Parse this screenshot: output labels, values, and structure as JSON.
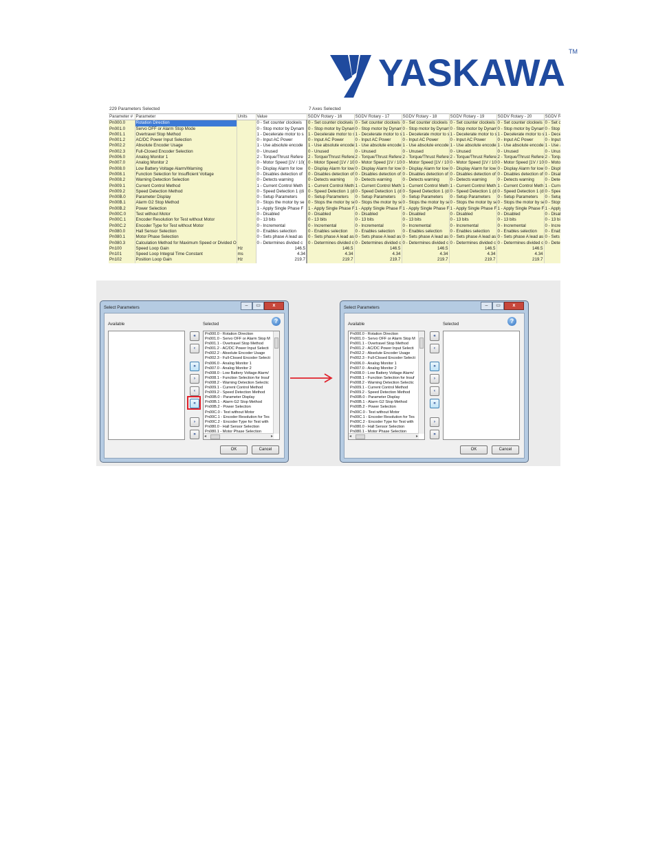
{
  "logo": {
    "text": "YASKAWA",
    "tm": "TM",
    "color": "#1f4a9e"
  },
  "grid": {
    "params_caption": "229 Parameters Selected",
    "axes_caption": "7 Axes Selected",
    "headers": [
      "Parameter #",
      "Parameter",
      "Units",
      "Value",
      "SGDV Rotary - 16",
      "SGDV Rotary - 17",
      "SGDV Rotary - 18",
      "SGDV Rotary - 19",
      "SGDV Rotary - 20",
      "SGDV Rotary - 21"
    ],
    "rows": [
      {
        "id": "Pn000.0",
        "name": "Rotation Direction",
        "units": "",
        "value": "0 - Set counter clockwis",
        "axis": "0 - Set counter clockwis"
      },
      {
        "id": "Pn001.0",
        "name": "Servo OFF or Alarm Stop Mode",
        "units": "",
        "value": "0 - Stop motor by Dynam",
        "axis": "0 - Stop motor by Dynam"
      },
      {
        "id": "Pn001.1",
        "name": "Overtravel Stop Method",
        "units": "",
        "value": "1 - Decelerate motor to s",
        "axis": "1 - Decelerate motor to s"
      },
      {
        "id": "Pn001.2",
        "name": "AC/DC Power Input Selection",
        "units": "",
        "value": "0 - Input AC Power",
        "axis": "0 - Input AC Power"
      },
      {
        "id": "Pn002.2",
        "name": "Absolute Encoder Usage",
        "units": "",
        "value": "1 - Use absolute encode",
        "axis": "1 - Use absolute encode"
      },
      {
        "id": "Pn002.3",
        "name": "Full-Closed Encoder Selection",
        "units": "",
        "value": "0 - Unused",
        "axis": "0 - Unused"
      },
      {
        "id": "Pn006.0",
        "name": "Analog Monitor 1",
        "units": "",
        "value": "2 - Torque/Thrust Refere",
        "axis": "2 - Torque/Thrust Refere"
      },
      {
        "id": "Pn007.0",
        "name": "Analog Monitor 2",
        "units": "",
        "value": "0 - Motor Speed [1V / 10(",
        "axis": "0 - Motor Speed [1V / 10("
      },
      {
        "id": "Pn008.0",
        "name": "Low Battery Voltage Alarm/Warning",
        "units": "",
        "value": "0 - Display Alarm for low",
        "axis": "0 - Display Alarm for low"
      },
      {
        "id": "Pn008.1",
        "name": "Function Selection for Insufficient Voltage",
        "units": "",
        "value": "0 - Disables detection of",
        "axis": "0 - Disables detection of"
      },
      {
        "id": "Pn008.2",
        "name": "Warning Detection Selection",
        "units": "",
        "value": "0 - Detects warning",
        "axis": "0 - Detects warning"
      },
      {
        "id": "Pn009.1",
        "name": "Current Control Method",
        "units": "",
        "value": "1 - Current Control Meth",
        "axis": "1 - Current Control Meth"
      },
      {
        "id": "Pn009.2",
        "name": "Speed Detection Method",
        "units": "",
        "value": "0 - Speed Detection 1 (di",
        "axis": "0 - Speed Detection 1 (di"
      },
      {
        "id": "Pn00B.0",
        "name": "Parameter Display",
        "units": "",
        "value": "0 - Setup Parameters",
        "axis": "0 - Setup Parameters"
      },
      {
        "id": "Pn00B.1",
        "name": "Alarm G2 Stop Method",
        "units": "",
        "value": "0 - Stops the motor by se",
        "axis": "0 - Stops the motor by se"
      },
      {
        "id": "Pn00B.2",
        "name": "Power Selection",
        "units": "",
        "value": "1 - Apply Single Phase F",
        "axis": "1 - Apply Single Phase F"
      },
      {
        "id": "Pn00C.0",
        "name": "Test without Motor",
        "units": "",
        "value": "0 - Disabled",
        "axis": "0 - Disabled"
      },
      {
        "id": "Pn00C.1",
        "name": "Encoder Resolution for Test without Motor",
        "units": "",
        "value": "0 - 13 bits",
        "axis": "0 - 13 bits"
      },
      {
        "id": "Pn00C.2",
        "name": "Encoder Type for Test without Motor",
        "units": "",
        "value": "0 - Incremental",
        "axis": "0 - Incremental"
      },
      {
        "id": "Pn080.0",
        "name": "Hall Sensor Selection",
        "units": "",
        "value": "0 - Enables selection",
        "axis": "0 - Enables selection"
      },
      {
        "id": "Pn080.1",
        "name": "Motor Phase Selection",
        "units": "",
        "value": "0 - Sets phase A lead as",
        "axis": "0 - Sets phase A lead as"
      },
      {
        "id": "Pn080.3",
        "name": "Calculation Method for Maximum Speed or Divided Ou",
        "units": "",
        "value": "0 - Determines divided c",
        "axis": "0 - Determines divided c"
      },
      {
        "id": "Pn100",
        "name": "Speed Loop Gain",
        "units": "Hz",
        "value": "146.5",
        "axis": "146.5"
      },
      {
        "id": "Pn101",
        "name": "Speed Loop Integral Time Constant",
        "units": "ms",
        "value": "4.34",
        "axis": "4.34"
      },
      {
        "id": "Pn102",
        "name": "Position Loop Gain",
        "units": "Hz",
        "value": "219.7",
        "axis": "219.7"
      }
    ]
  },
  "dialog_left": {
    "title": "Select Parameters",
    "available_label": "Available",
    "selected_label": "Selected",
    "ok": "OK",
    "cancel": "Cancel",
    "selected_items": [
      "Pn000.0 - Rotation Direction",
      "Pn001.0 - Servo OFF or Alarm Stop M",
      "Pn001.1 - Overtravel Stop Method",
      "Pn001.2 - AC/DC Power Input Selecti",
      "Pn002.2 - Absolute Encoder Usage",
      "Pn002.3 - Full-Closed Encoder Selecti",
      "Pn006.0 - Analog Monitor 1",
      "Pn007.0 - Analog Monitor 2",
      "Pn008.0 - Low Battery Voltage Alarm/",
      "Pn008.1 - Function Selection for Insuf",
      "Pn008.2 - Warning Detection Selectic",
      "Pn009.1 - Current Control Method",
      "Pn009.2 - Speed Detection Method",
      "Pn00B.0 - Parameter Display",
      "Pn00B.1 - Alarm G2 Stop Method",
      "Pn00B.2 - Power Selection",
      "Pn00C.0 - Test without Motor",
      "Pn00C.1 - Encoder Resolution for Tes",
      "Pn00C.2 - Encoder Type for Test with",
      "Pn080.0 - Hall Sensor Selection",
      "Pn080.1 - Motor Phase Selection"
    ]
  },
  "dialog_right": {
    "title": "Select Parameters",
    "available_label": "Available",
    "selected_label": "Selected",
    "ok": "OK",
    "cancel": "Cancel",
    "available_items": [
      "Pn000.0 - Rotation Direction",
      "Pn001.0 - Servo OFF or Alarm Stop M",
      "Pn001.1 - Overtravel Stop Method",
      "Pn001.2 - AC/DC Power Input Selecti",
      "Pn002.2 - Absolute Encoder Usage",
      "Pn002.3 - Full-Closed Encoder Selecti",
      "Pn006.0 - Analog Monitor 1",
      "Pn007.0 - Analog Monitor 2",
      "Pn008.0 - Low Battery Voltage Alarm/",
      "Pn008.1 - Function Selection for Insuf",
      "Pn008.2 - Warning Detection Selectic",
      "Pn009.1 - Current Control Method",
      "Pn009.2 - Speed Detection Method",
      "Pn00B.0 - Parameter Display",
      "Pn00B.1 - Alarm G2 Stop Method",
      "Pn00B.2 - Power Selection",
      "Pn00C.0 - Test without Motor",
      "Pn00C.1 - Encoder Resolution for Tes",
      "Pn00C.2 - Encoder Type for Test with",
      "Pn080.0 - Hall Sensor Selection",
      "Pn080.1 - Motor Phase Selection"
    ]
  },
  "icons": {
    "move_top": "«",
    "move_up": "‹",
    "add_all": "»",
    "add_one": "›",
    "remove_one": "‹",
    "remove_all": "«",
    "move_down": "›",
    "move_bottom": "»",
    "help": "?",
    "minimize": "–",
    "maximize": "▭",
    "close": "x",
    "scroll_left": "◂",
    "scroll_right": "▸"
  },
  "colors": {
    "highlight": "#e0202a",
    "param_bg": "#f6f6cc",
    "selection": "#3b79d6"
  }
}
